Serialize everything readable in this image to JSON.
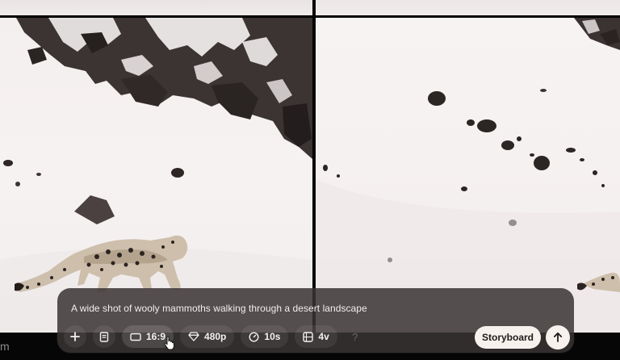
{
  "prompt": {
    "text": "A wide shot of wooly mammoths walking through a desert landscape"
  },
  "toolbar": {
    "add_icon": "plus-icon",
    "preset_icon": "book-icon",
    "aspect_ratio": {
      "icon": "aspect-ratio-icon",
      "label": "16:9"
    },
    "resolution": {
      "icon": "diamond-icon",
      "label": "480p"
    },
    "duration": {
      "icon": "clock-icon",
      "label": "10s"
    },
    "variations": {
      "icon": "grid-icon",
      "label": "4v"
    },
    "help_label": "?"
  },
  "storyboard_label": "Storyboard",
  "send_icon": "arrow-up-icon",
  "left_edge_letter": "m",
  "colors": {
    "panel_bg": "#3a3434",
    "primary_button_bg": "#f6f1ed",
    "snow": "#f4efef",
    "rock": "#2b2524"
  }
}
